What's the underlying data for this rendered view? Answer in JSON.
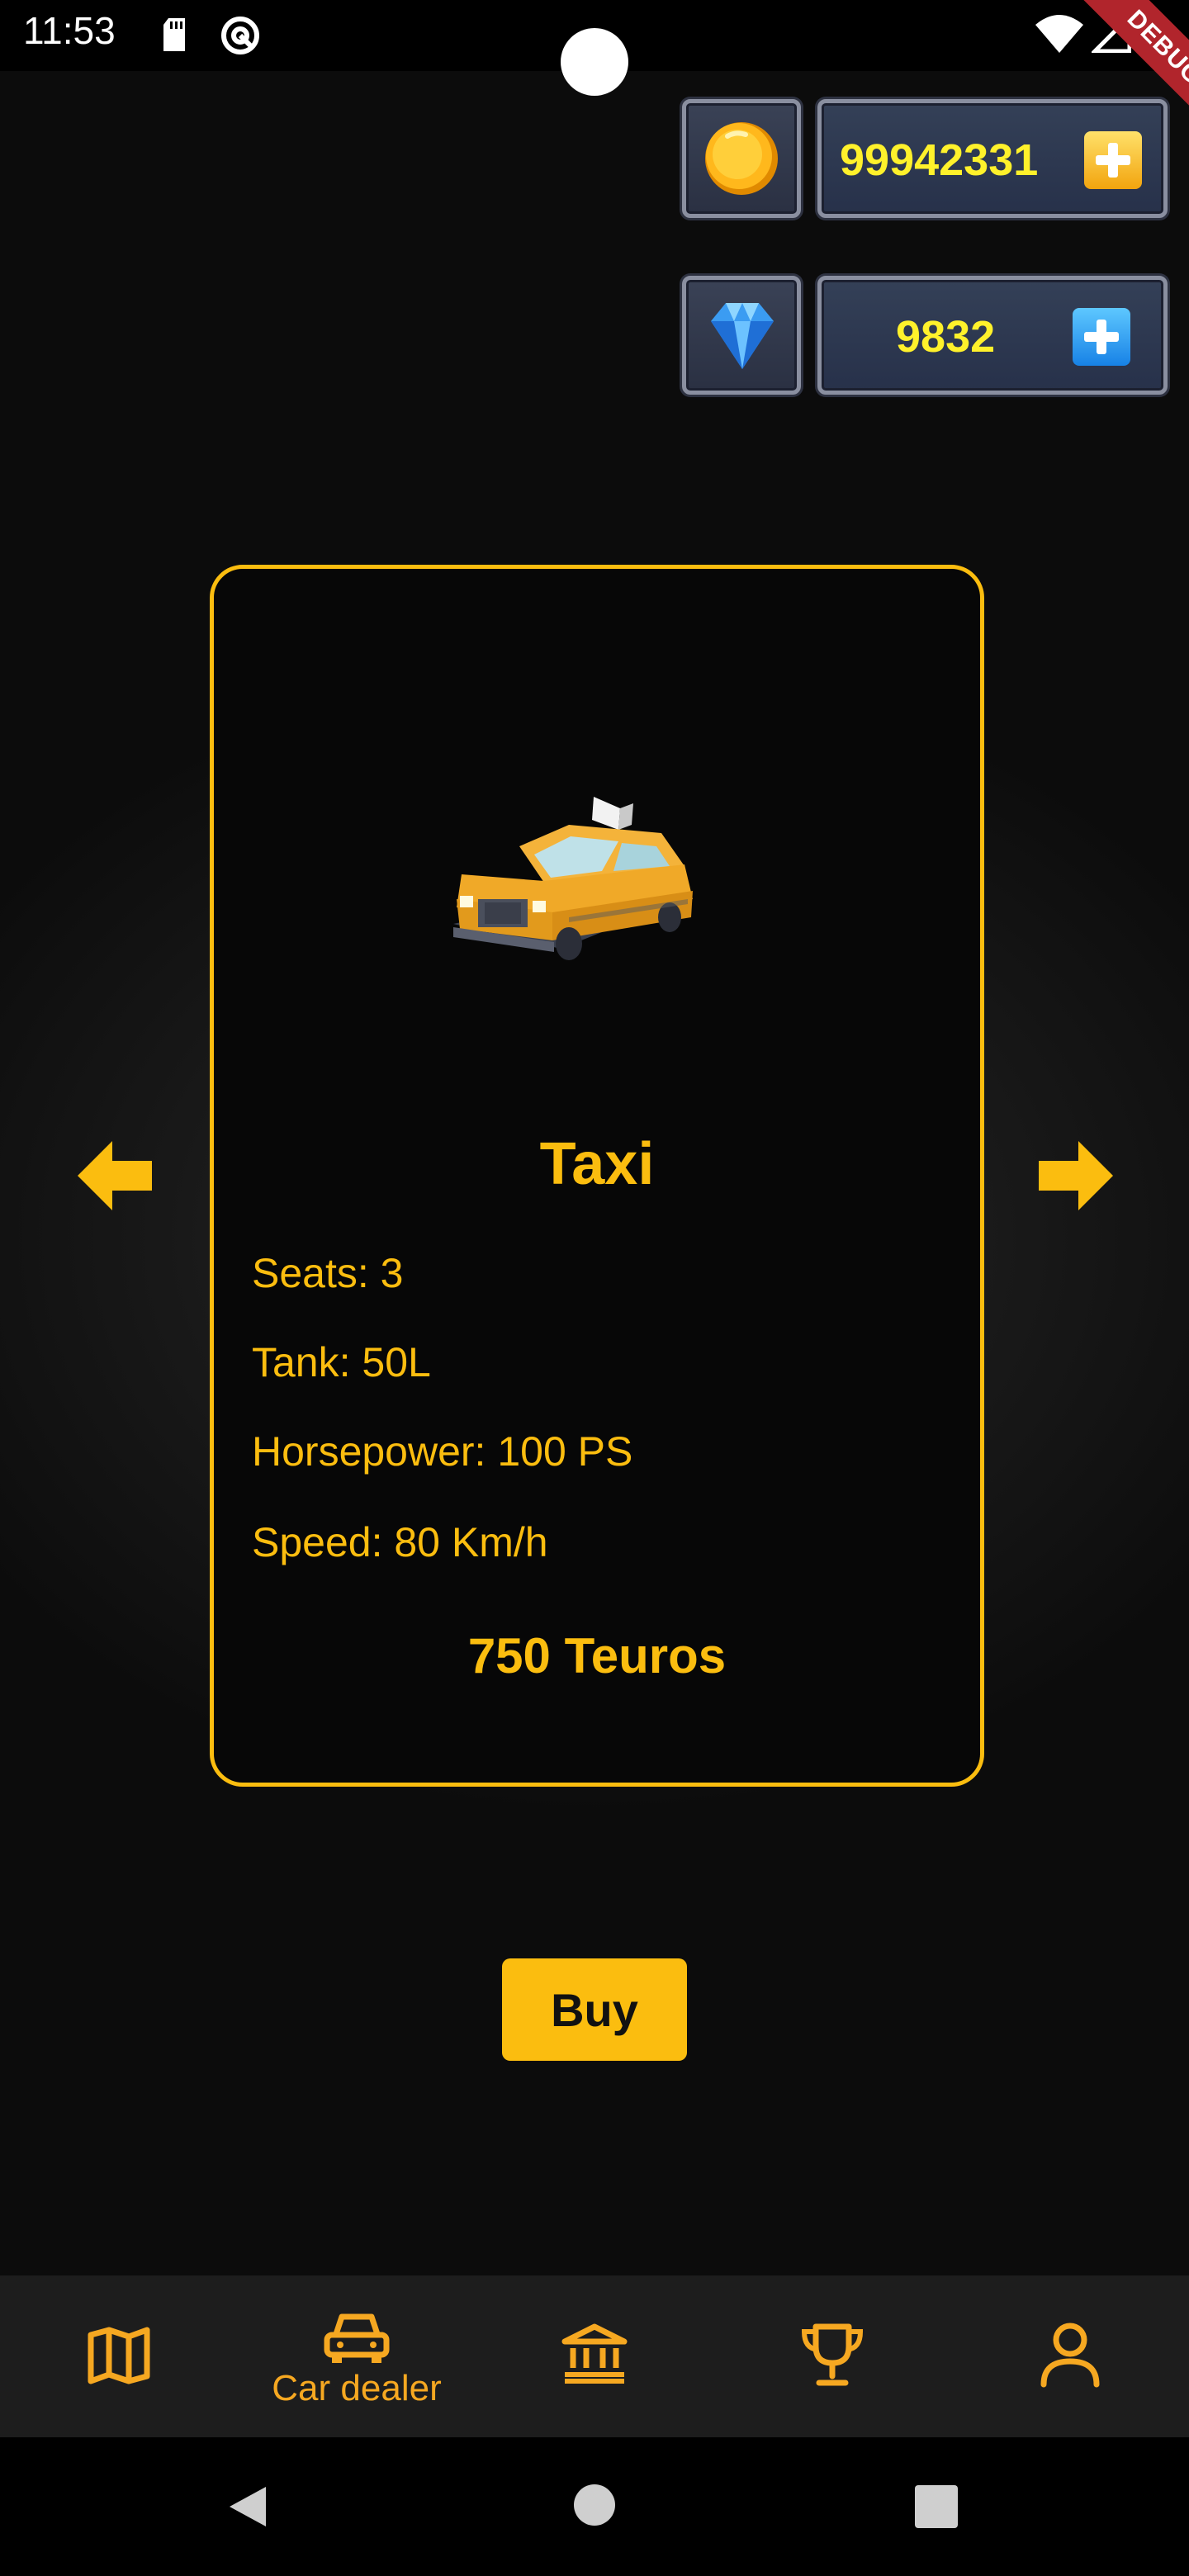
{
  "status_bar": {
    "time": "11:53",
    "debug_label": "DEBUG"
  },
  "currency": {
    "coins": {
      "icon": "gold-coin-icon",
      "value": "99942331"
    },
    "gems": {
      "icon": "diamond-icon",
      "value": "9832"
    }
  },
  "car": {
    "name": "Taxi",
    "image": "taxi-car",
    "specs": [
      "Seats: 3",
      "Tank: 50L",
      "Horsepower: 100 PS",
      "Speed: 80 Km/h"
    ],
    "price": "750 Teuros"
  },
  "buy_label": "Buy",
  "nav": {
    "active": "car-dealer",
    "items": [
      {
        "icon": "map-icon",
        "label": ""
      },
      {
        "icon": "car-icon",
        "label": "Car dealer"
      },
      {
        "icon": "bank-icon",
        "label": ""
      },
      {
        "icon": "trophy-icon",
        "label": ""
      },
      {
        "icon": "person-icon",
        "label": ""
      }
    ]
  },
  "colors": {
    "accent": "#fbbd0f",
    "nav_icon": "#f6a821",
    "currency_text": "#fff12b"
  }
}
